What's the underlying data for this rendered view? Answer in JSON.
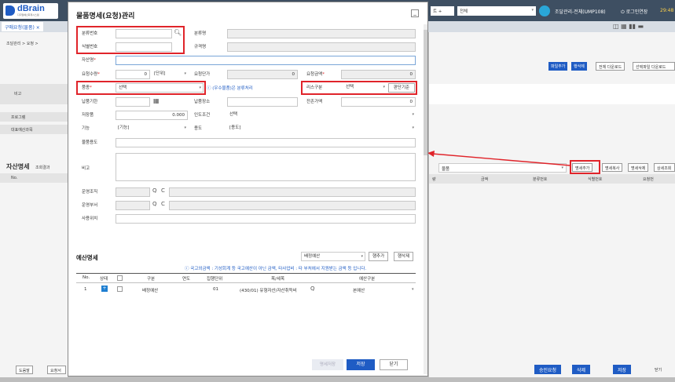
{
  "app": {
    "brand": "dBrain",
    "brand_sub": "디지털예산회계시스템",
    "user": "조달관리-전체(UMP108)",
    "logout": "로그인연장",
    "time": "29:48",
    "top_dd1": "트 +",
    "top_dd2": "전체"
  },
  "bg": {
    "tab": "구매요청(물품) ×",
    "breadcrumb": "조달관리 > 요청 >",
    "row_labels": [
      "비고",
      "프로그램",
      "대표예산과목"
    ],
    "buttons_right": [
      "파일추가",
      "행삭제",
      "전체 다운로드",
      "선택파일 다운로드"
    ],
    "asset_title": "자산명세",
    "asset_sub": "조회결과",
    "asset_col_no": "No.",
    "asset_select": "물품",
    "asset_buttons": [
      "명세추가",
      "명세복사",
      "명세삭제",
      "상세조회"
    ],
    "asset_cols": [
      "량",
      "금액",
      "분류번호",
      "식별번호",
      "요청번"
    ],
    "bottom_left": [
      "도움말",
      "요청서"
    ],
    "bottom_right": [
      "승인요청",
      "삭제",
      "저장",
      "닫기"
    ]
  },
  "modal": {
    "title": "물품명세(요청)관리",
    "close": "_",
    "labels": {
      "cls_no": "분류번호",
      "cls_name": "분류명",
      "id_no": "식별번호",
      "spec": "규격명",
      "asset_name": "자산명",
      "qty": "요청수량",
      "unit_price": "요청단가",
      "amount": "요청금액",
      "item": "품종",
      "risk": "리스구분",
      "delivery": "납품기한",
      "place": "납품장소",
      "lease_amt": "잔존가액",
      "reserve": "저장품",
      "terms": "인도조건",
      "func": "기능",
      "usage": "용도",
      "purpose": "물품용도",
      "note": "비고",
      "org": "운영조직",
      "dept": "운영부서",
      "location": "사용위치"
    },
    "values": {
      "qty": "0",
      "unit_sel": "[단위]",
      "unit_price": "0",
      "amount": "0",
      "item_sel": "선택",
      "info_link": "(우수물품)은 분류처리",
      "risk_sel": "선택",
      "judge_btn": "판단기준",
      "lease_amt": "0",
      "reserve": "0.000",
      "terms_sel": "선택",
      "func_sel": "[기능]",
      "usage_sel": "[용도]"
    },
    "budget": {
      "title": "예산명세",
      "select": "배정예산",
      "add_btn": "행추가",
      "del_btn": "행삭제",
      "info": "국고외금액 : 기성회계 등 국고예산이 아닌 금액, 타사업비 : 타 부처에서 지원받는 금액 등 입니다.",
      "cols": [
        "No.",
        "상태",
        "구분",
        "연도",
        "집행단위",
        "목/세목",
        "예산구분"
      ],
      "row": {
        "no": "1",
        "type": "배정예산",
        "unit": "01",
        "item": "(430/01) 유형자산/자산취득비",
        "kind": "본예산"
      }
    },
    "footer": {
      "disabled": "명세저장",
      "save": "저장",
      "close": "닫기"
    }
  },
  "colors": {
    "accent": "#1f5cc4",
    "highlight": "#e0242a",
    "topbar": "#3e4f62"
  }
}
